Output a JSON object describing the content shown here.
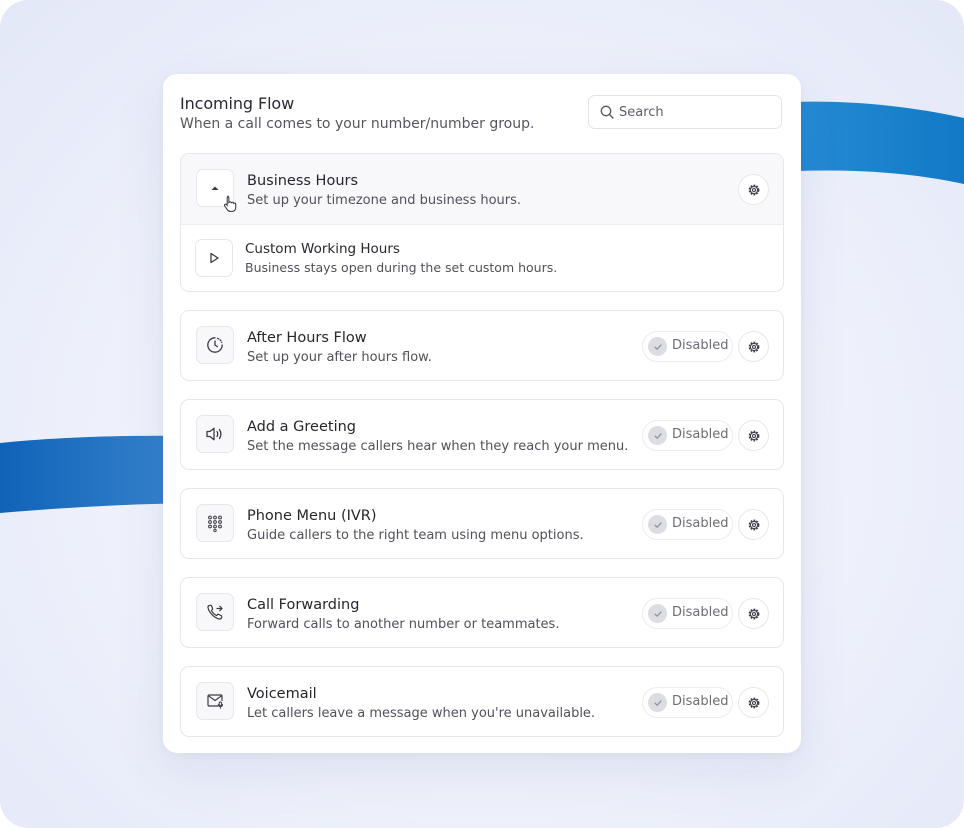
{
  "header": {
    "title": "Incoming Flow",
    "subtitle": "When a call comes to your number/number group."
  },
  "search": {
    "placeholder": "Search",
    "value": ""
  },
  "business_hours": {
    "title": "Business Hours",
    "description": "Set up your timezone and business hours.",
    "expanded": true,
    "sub_item": {
      "title": "Custom Working Hours",
      "description": "Business stays open during the set custom hours."
    }
  },
  "flows": [
    {
      "title": "After Hours Flow",
      "description": "Set up your after hours flow.",
      "status": "Disabled",
      "icon": "clock-icon"
    },
    {
      "title": "Add a Greeting",
      "description": "Set the message callers hear when they reach your menu.",
      "status": "Disabled",
      "icon": "speaker-icon"
    },
    {
      "title": "Phone Menu (IVR)",
      "description": "Guide callers to the right team using menu options.",
      "status": "Disabled",
      "icon": "dialpad-icon"
    },
    {
      "title": "Call Forwarding",
      "description": "Forward calls to another number or teammates.",
      "status": "Disabled",
      "icon": "phone-forward-icon"
    },
    {
      "title": "Voicemail",
      "description": "Let callers leave a message when you're unavailable.",
      "status": "Disabled",
      "icon": "voicemail-icon"
    }
  ],
  "colors": {
    "accent_blue": "#1a7cc9",
    "card_bg": "#ffffff",
    "page_bg": "#eef1fb"
  }
}
